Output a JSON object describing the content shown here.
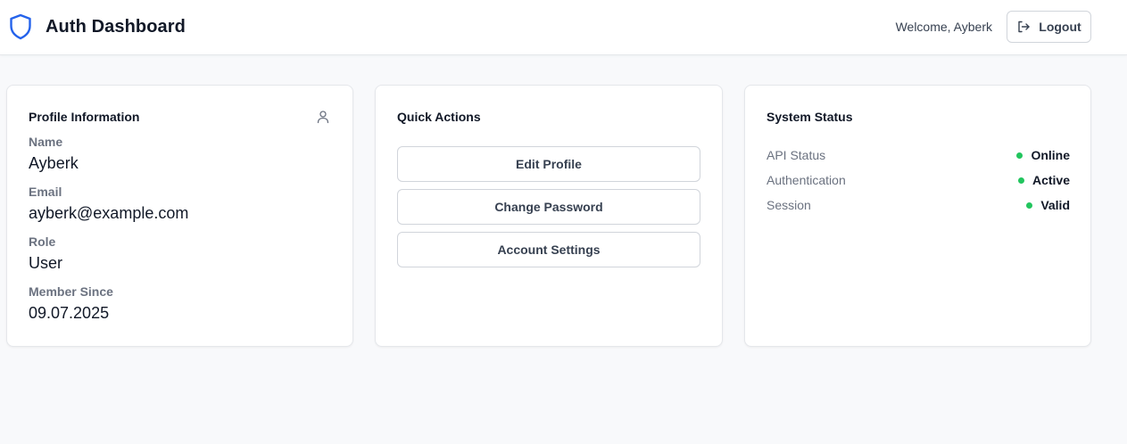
{
  "header": {
    "title": "Auth Dashboard",
    "welcome": "Welcome, Ayberk",
    "logout_label": "Logout"
  },
  "profile": {
    "title": "Profile Information",
    "fields": [
      {
        "label": "Name",
        "value": "Ayberk"
      },
      {
        "label": "Email",
        "value": "ayberk@example.com"
      },
      {
        "label": "Role",
        "value": "User"
      },
      {
        "label": "Member Since",
        "value": "09.07.2025"
      }
    ]
  },
  "quick_actions": {
    "title": "Quick Actions",
    "buttons": [
      "Edit Profile",
      "Change Password",
      "Account Settings"
    ]
  },
  "system_status": {
    "title": "System Status",
    "items": [
      {
        "label": "API Status",
        "value": "Online"
      },
      {
        "label": "Authentication",
        "value": "Active"
      },
      {
        "label": "Session",
        "value": "Valid"
      }
    ]
  },
  "colors": {
    "accent": "#2563eb",
    "status_ok": "#22c55e"
  },
  "icons": {
    "brand": "shield-icon",
    "logout": "logout-icon",
    "profile": "user-icon",
    "status": "status-dot"
  }
}
